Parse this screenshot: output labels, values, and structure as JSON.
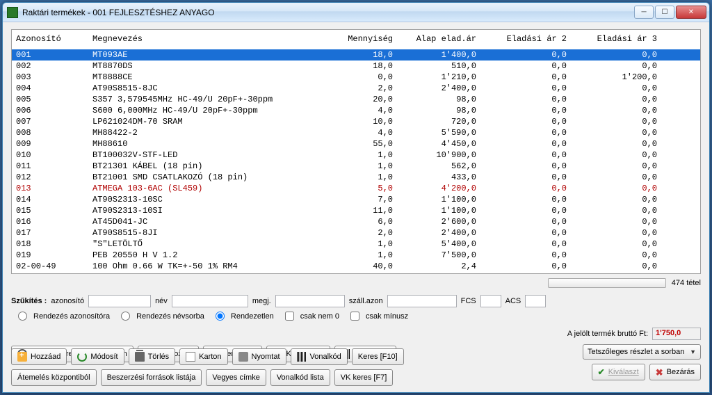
{
  "window": {
    "title": "Raktári termékek - 001 FEJLESZTÉSHEZ ANYAGO",
    "min": "—",
    "max": "□",
    "close": "X"
  },
  "grid": {
    "headers": {
      "id": "Azonosító",
      "name": "Megnevezés",
      "qty": "Mennyiség",
      "price1": "Alap elad.ár",
      "price2": "Eladási ár 2",
      "price3": "Eladási ár 3"
    },
    "rows": [
      {
        "id": "001",
        "name": "MT093AE",
        "qty": "18,0",
        "p1": "1'400,0",
        "p2": "0,0",
        "p3": "0,0",
        "sel": true
      },
      {
        "id": "002",
        "name": "MT8870DS",
        "qty": "18,0",
        "p1": "510,0",
        "p2": "0,0",
        "p3": "0,0"
      },
      {
        "id": "003",
        "name": "MT8888CE",
        "qty": "0,0",
        "p1": "1'210,0",
        "p2": "0,0",
        "p3": "1'200,0"
      },
      {
        "id": "004",
        "name": "AT90S8515-8JC",
        "qty": "2,0",
        "p1": "2'400,0",
        "p2": "0,0",
        "p3": "0,0"
      },
      {
        "id": "005",
        "name": "S357 3,579545MHz HC-49/U 20pF+-30ppm",
        "qty": "20,0",
        "p1": "98,0",
        "p2": "0,0",
        "p3": "0,0"
      },
      {
        "id": "006",
        "name": "S600 6,000MHz HC-49/U 20pF+-30ppm",
        "qty": "4,0",
        "p1": "98,0",
        "p2": "0,0",
        "p3": "0,0"
      },
      {
        "id": "007",
        "name": "LP621024DM-70 SRAM",
        "qty": "10,0",
        "p1": "720,0",
        "p2": "0,0",
        "p3": "0,0"
      },
      {
        "id": "008",
        "name": "MH88422-2",
        "qty": "4,0",
        "p1": "5'590,0",
        "p2": "0,0",
        "p3": "0,0"
      },
      {
        "id": "009",
        "name": "MH88610",
        "qty": "55,0",
        "p1": "4'450,0",
        "p2": "0,0",
        "p3": "0,0"
      },
      {
        "id": "010",
        "name": "BT100032V-STF-LED",
        "qty": "1,0",
        "p1": "10'900,0",
        "p2": "0,0",
        "p3": "0,0"
      },
      {
        "id": "011",
        "name": "BT21301 KÁBEL (18 pin)",
        "qty": "1,0",
        "p1": "562,0",
        "p2": "0,0",
        "p3": "0,0"
      },
      {
        "id": "012",
        "name": "BT21001 SMD CSATLAKOZÓ (18 pin)",
        "qty": "1,0",
        "p1": "433,0",
        "p2": "0,0",
        "p3": "0,0"
      },
      {
        "id": "013",
        "name": "ATMEGA 103-6AC (SL459)",
        "qty": "5,0",
        "p1": "4'200,0",
        "p2": "0,0",
        "p3": "0,0",
        "special": true
      },
      {
        "id": "014",
        "name": "AT90S2313-10SC",
        "qty": "7,0",
        "p1": "1'100,0",
        "p2": "0,0",
        "p3": "0,0"
      },
      {
        "id": "015",
        "name": "AT90S2313-10SI",
        "qty": "11,0",
        "p1": "1'100,0",
        "p2": "0,0",
        "p3": "0,0"
      },
      {
        "id": "016",
        "name": "AT45D041-JC",
        "qty": "6,0",
        "p1": "2'600,0",
        "p2": "0,0",
        "p3": "0,0"
      },
      {
        "id": "017",
        "name": "AT90S8515-8JI",
        "qty": "2,0",
        "p1": "2'400,0",
        "p2": "0,0",
        "p3": "0,0"
      },
      {
        "id": "018",
        "name": "\"S\"LETÖLTŐ",
        "qty": "1,0",
        "p1": "5'400,0",
        "p2": "0,0",
        "p3": "0,0"
      },
      {
        "id": "019",
        "name": "PEB 20550 H V 1.2",
        "qty": "1,0",
        "p1": "7'500,0",
        "p2": "0,0",
        "p3": "0,0"
      },
      {
        "id": "02-00-49",
        "name": "100 Ohm 0.66 W TK=+-50 1% RM4",
        "qty": "40,0",
        "p1": "2,4",
        "p2": "0,0",
        "p3": "0,0"
      }
    ]
  },
  "count_label": "474 tétel",
  "filters": {
    "title": "Szűkítés :",
    "id": "azonosító",
    "name": "név",
    "note": "megj.",
    "supplier": "száll.azon",
    "fcs": "FCS",
    "acs": "ACS"
  },
  "sort": {
    "by_id": "Rendezés azonosítóra",
    "by_name": "Rendezés névsorba",
    "unsorted": "Rendezetlen",
    "nonzero": "csak nem 0",
    "minus": "csak mínusz"
  },
  "buttons": {
    "search_stock": "Készlet keresés raktárakban",
    "move_up": "Felmozgat",
    "move_down": "Lemozgat",
    "stock_value": "Készl.érték",
    "collect_code": "Gyűjtő kód",
    "add": "Hozzáad",
    "modify": "Módosít",
    "delete": "Törlés",
    "card": "Karton",
    "print": "Nyomtat",
    "barcode": "Vonalkód",
    "search": "Keres [F10]",
    "lift_central": "Átemelés központiból",
    "source_list": "Beszerzési források listája",
    "mixed_label": "Vegyes címke",
    "barcode_list": "Vonalkód lista",
    "vk_search": "VK keres [F7]",
    "select": "Kiválaszt",
    "close": "Bezárás"
  },
  "brutto": {
    "label": "A jelölt termék bruttó Ft:",
    "value": "1'750,0"
  },
  "combo": {
    "label": "Tetszőleges részlet a sorban"
  }
}
